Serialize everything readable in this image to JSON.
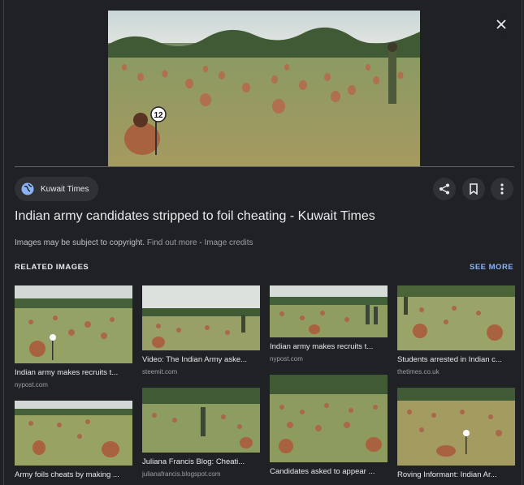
{
  "hero": {
    "alt": "Candidates sitting in a field taking an exam",
    "badge_number": "12"
  },
  "source": {
    "name": "Kuwait Times"
  },
  "title": "Indian army candidates stripped to foil cheating - Kuwait Times",
  "copyright": {
    "text": "Images may be subject to copyright.",
    "find_out_more": "Find out more",
    "separator": "-",
    "image_credits": "Image credits"
  },
  "related": {
    "heading": "RELATED IMAGES",
    "see_more": "SEE MORE",
    "items": [
      {
        "title": "Indian army makes recruits t...",
        "source": "nypost.com"
      },
      {
        "title": "Video: The Indian Army aske...",
        "source": "steemit.com"
      },
      {
        "title": "Indian army makes recruits t...",
        "source": "nypost.com"
      },
      {
        "title": "Students arrested in Indian c...",
        "source": "thetimes.co.uk"
      },
      {
        "title": "Army foils cheats by making ...",
        "source": ""
      },
      {
        "title": "Juliana Francis Blog: Cheati...",
        "source": "julianafrancis.blogspot.com"
      },
      {
        "title": "Candidates asked to appear ...",
        "source": ""
      },
      {
        "title": "Roving Informant: Indian Ar...",
        "source": ""
      }
    ]
  },
  "colors": {
    "background": "#202124",
    "accent": "#8ab4f8",
    "chip": "#303134"
  }
}
